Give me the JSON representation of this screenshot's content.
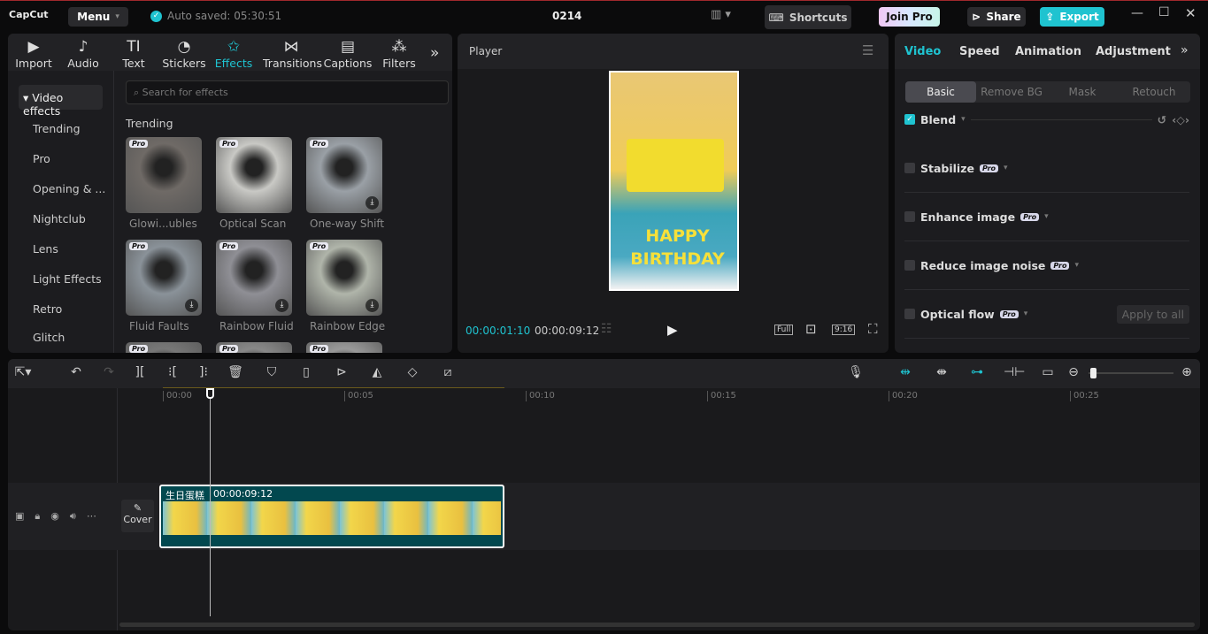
{
  "app": {
    "logo": "CapCut",
    "menu": "Menu",
    "autosave": "Auto saved: 05:30:51",
    "project": "0214",
    "shortcuts": "Shortcuts",
    "join_pro": "Join Pro",
    "share": "Share",
    "export": "Export",
    "accent": "#1fc3d0"
  },
  "media_tabs": [
    {
      "label": "Import",
      "icon": "▶"
    },
    {
      "label": "Audio",
      "icon": "♪"
    },
    {
      "label": "Text",
      "icon": "TI"
    },
    {
      "label": "Stickers",
      "icon": "◔"
    },
    {
      "label": "Effects",
      "icon": "✩"
    },
    {
      "label": "Transitions",
      "icon": "⋈"
    },
    {
      "label": "Captions",
      "icon": "▤"
    },
    {
      "label": "Filters",
      "icon": "⁂"
    }
  ],
  "effects": {
    "dropdown": "Video effects",
    "search_placeholder": "Search for effects",
    "section": "Trending",
    "categories": [
      "Trending",
      "Pro",
      "Opening & ...",
      "Nightclub",
      "Lens",
      "Light Effects",
      "Retro",
      "Glitch"
    ],
    "items": [
      {
        "name": "Glowi...ubles",
        "pro": "Pro"
      },
      {
        "name": "Optical Scan",
        "pro": "Pro"
      },
      {
        "name": "One-way Shift",
        "pro": "Pro"
      },
      {
        "name": "Fluid Faults",
        "pro": "Pro"
      },
      {
        "name": "Rainbow Fluid",
        "pro": "Pro"
      },
      {
        "name": "Rainbow Edge",
        "pro": "Pro"
      },
      {
        "name": "",
        "pro": "Pro"
      },
      {
        "name": "",
        "pro": "Pro"
      },
      {
        "name": "",
        "pro": "Pro"
      }
    ]
  },
  "player": {
    "title": "Player",
    "current": "00:00:01:10",
    "total": "00:00:09:12",
    "full": "Full",
    "ratio": "9:16",
    "video_text": "HAPPY BIRTHDAY"
  },
  "inspector": {
    "tabs": [
      "Video",
      "Speed",
      "Animation",
      "Adjustment"
    ],
    "subtabs": [
      "Basic",
      "Remove BG",
      "Mask",
      "Retouch"
    ],
    "options": [
      {
        "label": "Blend",
        "checked": true,
        "pro": ""
      },
      {
        "label": "Stabilize",
        "checked": false,
        "pro": "Pro"
      },
      {
        "label": "Enhance image",
        "checked": false,
        "pro": "Pro"
      },
      {
        "label": "Reduce image noise",
        "checked": false,
        "pro": "Pro"
      },
      {
        "label": "Optical flow",
        "checked": false,
        "pro": "Pro"
      }
    ],
    "apply_all": "Apply to all"
  },
  "timeline": {
    "ticks": [
      "00:00",
      "00:05",
      "00:10",
      "00:15",
      "00:20",
      "00:25"
    ],
    "clip_name": "生日蛋糕",
    "clip_duration": "00:00:09:12",
    "cover": "Cover",
    "playhead_seconds": 1.4
  }
}
